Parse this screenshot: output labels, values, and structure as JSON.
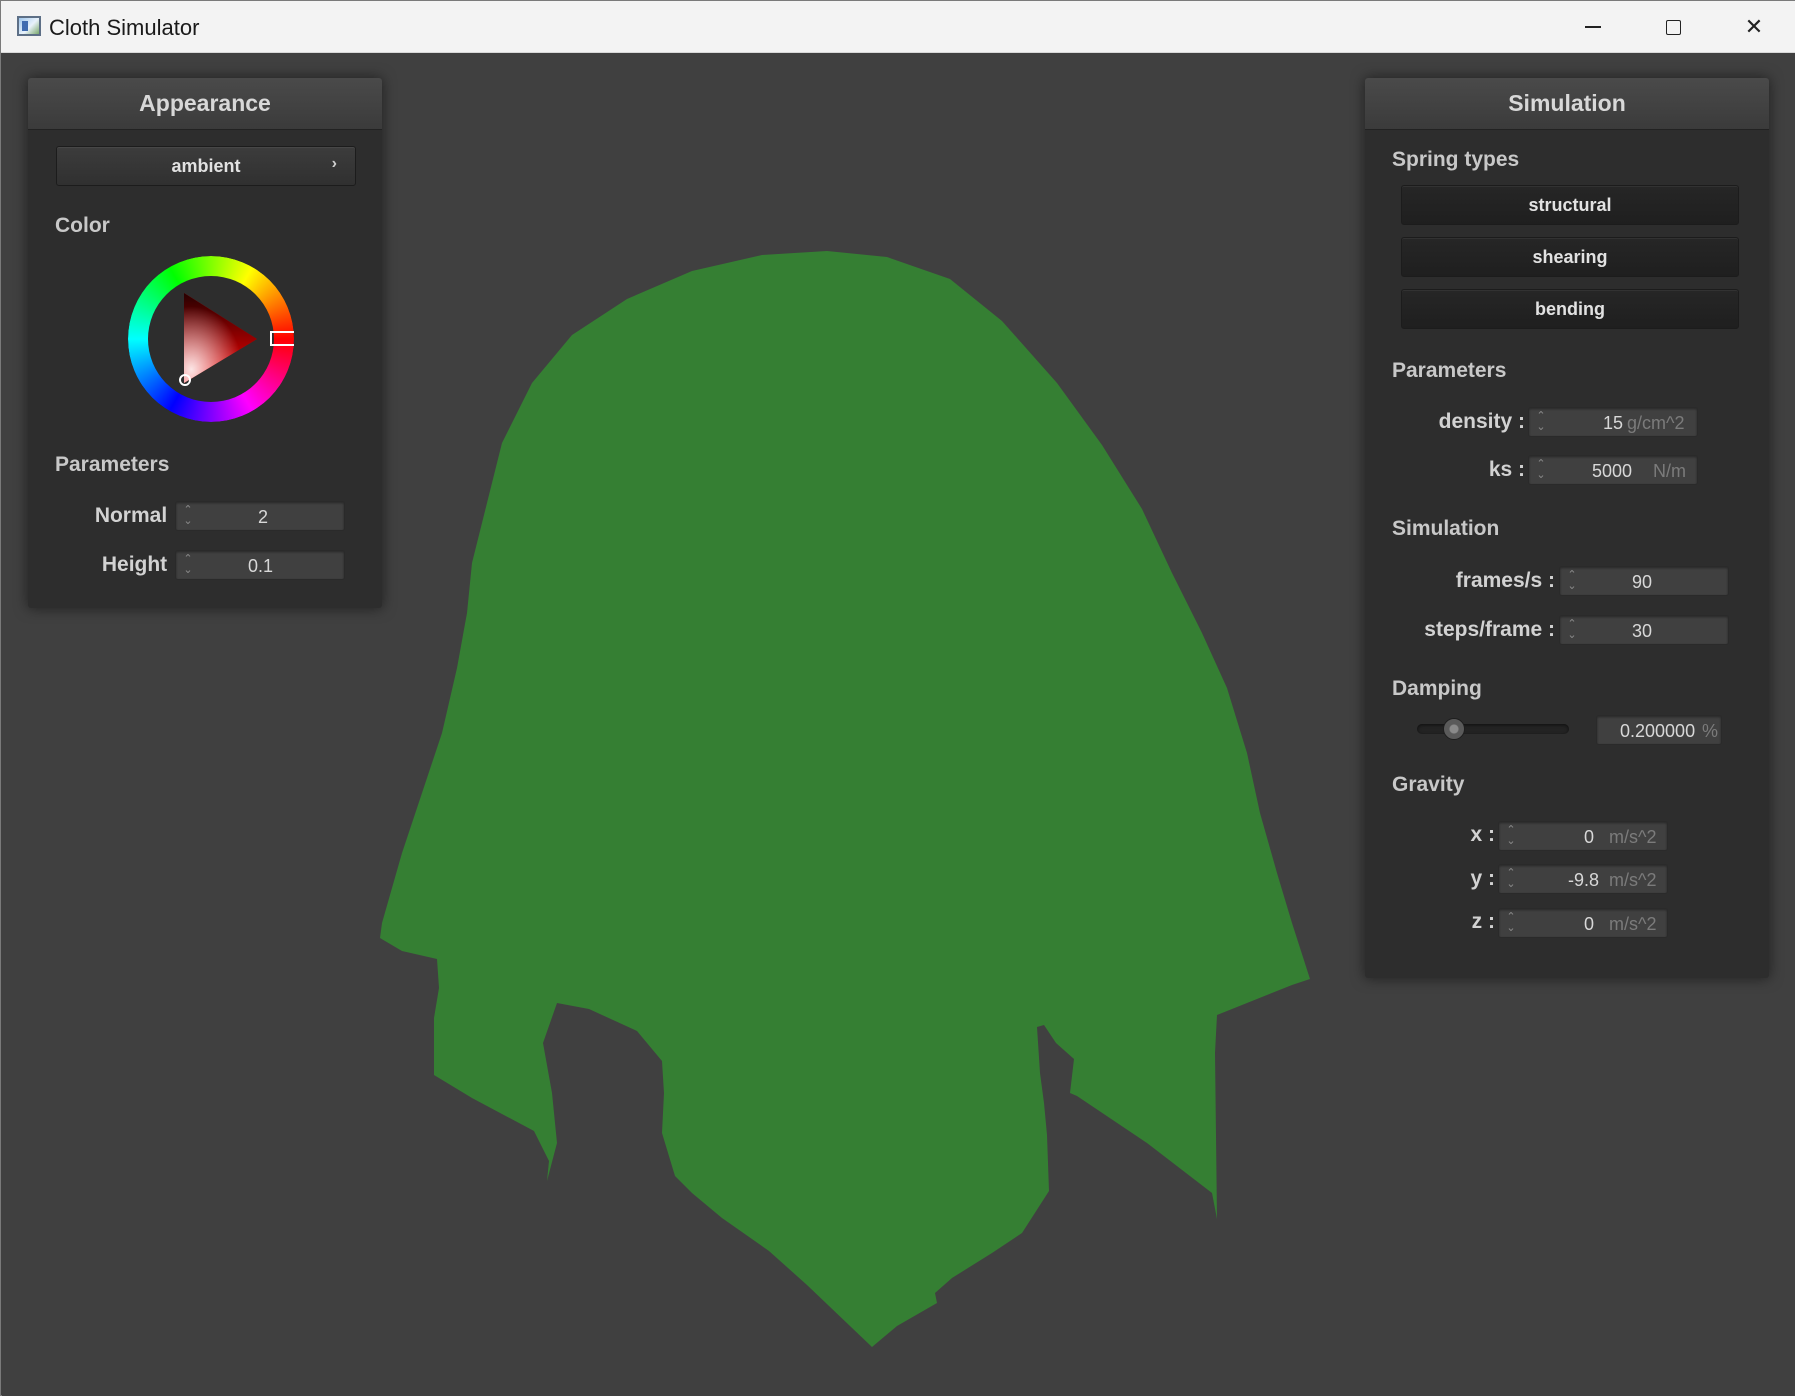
{
  "window": {
    "title": "Cloth Simulator",
    "icon": "app-icon",
    "minimize_icon": "minimize-icon",
    "maximize_icon": "maximize-icon",
    "close_glyph": "✕"
  },
  "scene": {
    "cloth_color": "#357f33",
    "background": "#404040"
  },
  "appearance": {
    "header": "Appearance",
    "shader_button": "ambient",
    "shader_chevron": "›",
    "color_section": "Color",
    "selected_color": "#ff0000",
    "params_section": "Parameters",
    "normal": {
      "label": "Normal :",
      "value": "2"
    },
    "height": {
      "label": "Height :",
      "value": "0.1"
    }
  },
  "simulation": {
    "header": "Simulation",
    "spring_section": "Spring types",
    "springs": [
      "structural",
      "shearing",
      "bending"
    ],
    "params_section": "Parameters",
    "density": {
      "label": "density :",
      "value": "15",
      "unit": "g/cm^2"
    },
    "ks": {
      "label": "ks :",
      "value": "5000",
      "unit": "N/m"
    },
    "sim_section": "Simulation",
    "fps": {
      "label": "frames/s :",
      "value": "90"
    },
    "steps": {
      "label": "steps/frame :",
      "value": "30"
    },
    "damping_section": "Damping",
    "damping": {
      "value": "0.200000",
      "unit": "%",
      "fraction": 0.2
    },
    "gravity_section": "Gravity",
    "gx": {
      "label": "x :",
      "value": "0",
      "unit": "m/s^2"
    },
    "gy": {
      "label": "y :",
      "value": "-9.8",
      "unit": "m/s^2"
    },
    "gz": {
      "label": "z :",
      "value": "0",
      "unit": "m/s^2"
    }
  }
}
